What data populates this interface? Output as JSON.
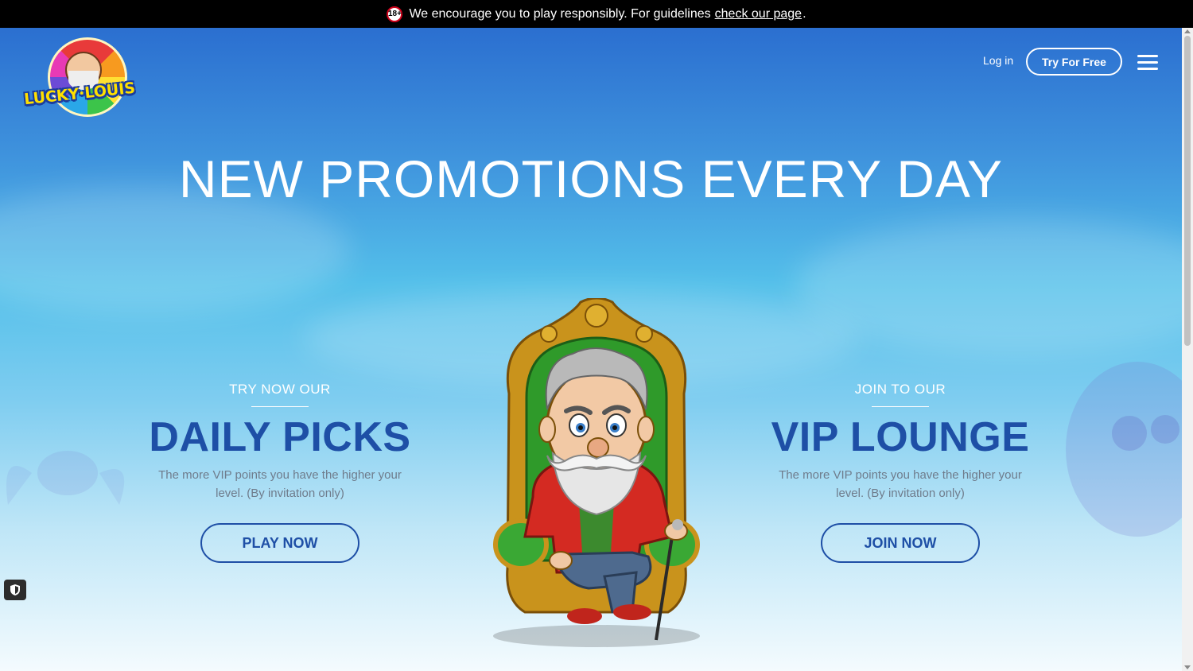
{
  "top_bar": {
    "age_badge": "18+",
    "message": "We encourage you to play responsibly. For guidelines",
    "link_text": "check our page",
    "suffix": "."
  },
  "header": {
    "logo_text": "LUCKY·LOUIS",
    "login_label": "Log in",
    "try_label": "Try For Free",
    "menu_icon": "hamburger-menu-icon"
  },
  "hero": {
    "headline": "NEW PROMOTIONS EVERY DAY",
    "character_icon": "character-on-throne-illustration"
  },
  "promos": [
    {
      "kicker": "TRY NOW OUR",
      "title": "DAILY PICKS",
      "description": "The more VIP points you have the higher your level. (By invitation only)",
      "button": "PLAY NOW"
    },
    {
      "kicker": "JOIN TO OUR",
      "title": "VIP LOUNGE",
      "description": "The more VIP points you have the higher your level. (By invitation only)",
      "button": "JOIN NOW"
    }
  ],
  "widget": {
    "icon": "shield-icon"
  },
  "colors": {
    "brand_blue": "#1e4fa6",
    "top_bar": "#000000",
    "text_white": "#ffffff",
    "desc_gray": "#6f7c8c"
  }
}
